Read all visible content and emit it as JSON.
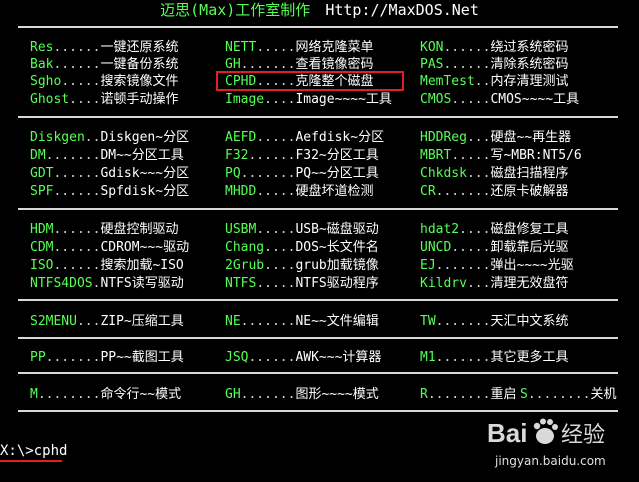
{
  "header": {
    "title": "迈思(Max)工作室制作",
    "url": "Http://MaxDOS.Net"
  },
  "sections": [
    {
      "items": [
        {
          "key": "Res",
          "dots": "......",
          "desc": "一键还原系统"
        },
        {
          "key": "NETT",
          "dots": ".....",
          "desc": "网络克隆菜单"
        },
        {
          "key": "KON",
          "dots": "......",
          "desc": "绕过系统密码"
        },
        {
          "key": "Bak",
          "dots": "......",
          "desc": "一键备份系统"
        },
        {
          "key": "GH",
          "dots": ".......",
          "desc": "查看镜像密码"
        },
        {
          "key": "PAS",
          "dots": "......",
          "desc": "清除系统密码"
        },
        {
          "key": "Sgho",
          "dots": ".....",
          "desc": "搜索镜像文件"
        },
        {
          "key": "CPHD",
          "dots": ".....",
          "desc": "克隆整个磁盘"
        },
        {
          "key": "MemTest",
          "dots": "..",
          "desc": "内存清理测试"
        },
        {
          "key": "Ghost",
          "dots": "....",
          "desc": "诺顿手动操作"
        },
        {
          "key": "Image",
          "dots": "....",
          "desc": "Image~~~~工具"
        },
        {
          "key": "CMOS",
          "dots": ".....",
          "desc": "CMOS~~~~工具"
        }
      ]
    },
    {
      "items": [
        {
          "key": "Diskgen",
          "dots": "..",
          "desc": "Diskgen~分区"
        },
        {
          "key": "AEFD",
          "dots": ".....",
          "desc": "Aefdisk~分区"
        },
        {
          "key": "HDDReg",
          "dots": "...",
          "desc": "硬盘~~再生器"
        },
        {
          "key": "DM",
          "dots": ".......",
          "desc": "DM~~分区工具"
        },
        {
          "key": "F32",
          "dots": "......",
          "desc": "F32~分区工具"
        },
        {
          "key": "MBRT",
          "dots": ".....",
          "desc": "写~MBR:NT5/6"
        },
        {
          "key": "GDT",
          "dots": "......",
          "desc": "Gdisk~~~分区"
        },
        {
          "key": "PQ",
          "dots": ".......",
          "desc": "PQ~~分区工具"
        },
        {
          "key": "Chkdsk",
          "dots": "...",
          "desc": "磁盘扫描程序"
        },
        {
          "key": "SPF",
          "dots": "......",
          "desc": "Spfdisk~分区"
        },
        {
          "key": "MHDD",
          "dots": ".....",
          "desc": "硬盘坏道检测"
        },
        {
          "key": "CR",
          "dots": ".......",
          "desc": "还原卡破解器"
        }
      ]
    },
    {
      "items": [
        {
          "key": "HDM",
          "dots": "......",
          "desc": "硬盘控制驱动"
        },
        {
          "key": "USBM",
          "dots": ".....",
          "desc": "USB~磁盘驱动"
        },
        {
          "key": "hdat2",
          "dots": "....",
          "desc": "磁盘修复工具"
        },
        {
          "key": "CDM",
          "dots": "......",
          "desc": "CDROM~~~驱动"
        },
        {
          "key": "Chang",
          "dots": "....",
          "desc": "DOS~长文件名"
        },
        {
          "key": "UNCD",
          "dots": ".....",
          "desc": "卸载靠后光驱"
        },
        {
          "key": "ISO",
          "dots": "......",
          "desc": "搜索加载~ISO"
        },
        {
          "key": "2Grub",
          "dots": "....",
          "desc": "grub加载镜像"
        },
        {
          "key": "EJ",
          "dots": ".......",
          "desc": "弹出~~~~光驱"
        },
        {
          "key": "NTFS4DOS",
          "dots": ".",
          "desc": "NTFS读写驱动"
        },
        {
          "key": "NTFS",
          "dots": ".....",
          "desc": "NTFS驱动程序"
        },
        {
          "key": "Kildrv",
          "dots": "...",
          "desc": "清理无效盘符"
        }
      ]
    },
    {
      "items": [
        {
          "key": "S2MENU",
          "dots": "...",
          "desc": "ZIP~压缩工具"
        },
        {
          "key": "NE",
          "dots": ".......",
          "desc": "NE~~文件编辑"
        },
        {
          "key": "TW",
          "dots": ".......",
          "desc": "天汇中文系统"
        }
      ]
    },
    {
      "items": [
        {
          "key": "PP",
          "dots": ".......",
          "desc": "PP~~截图工具"
        },
        {
          "key": "JSQ",
          "dots": "......",
          "desc": "AWK~~~计算器"
        },
        {
          "key": "M1",
          "dots": ".......",
          "desc": "其它更多工具"
        }
      ]
    },
    {
      "items": [
        {
          "key": "M",
          "dots": "........",
          "desc": "命令行~~模式"
        },
        {
          "key": "GH",
          "dots": ".......",
          "desc": "图形~~~~模式"
        },
        {
          "key": "R",
          "dots": "........",
          "desc": "重启"
        },
        {
          "key": "S",
          "dots": "........",
          "desc": "关机"
        }
      ]
    }
  ],
  "prompt": {
    "text": "X:\\>cphd"
  },
  "highlight": {
    "target": "CPHD"
  },
  "watermark": {
    "brand": "Baidu经验",
    "url": "jingyan.baidu.com"
  },
  "colors": {
    "background": "#000000",
    "key": "#55ff55",
    "text": "#ffffff",
    "rule": "#d7d7d7",
    "highlight": "#e02020"
  }
}
